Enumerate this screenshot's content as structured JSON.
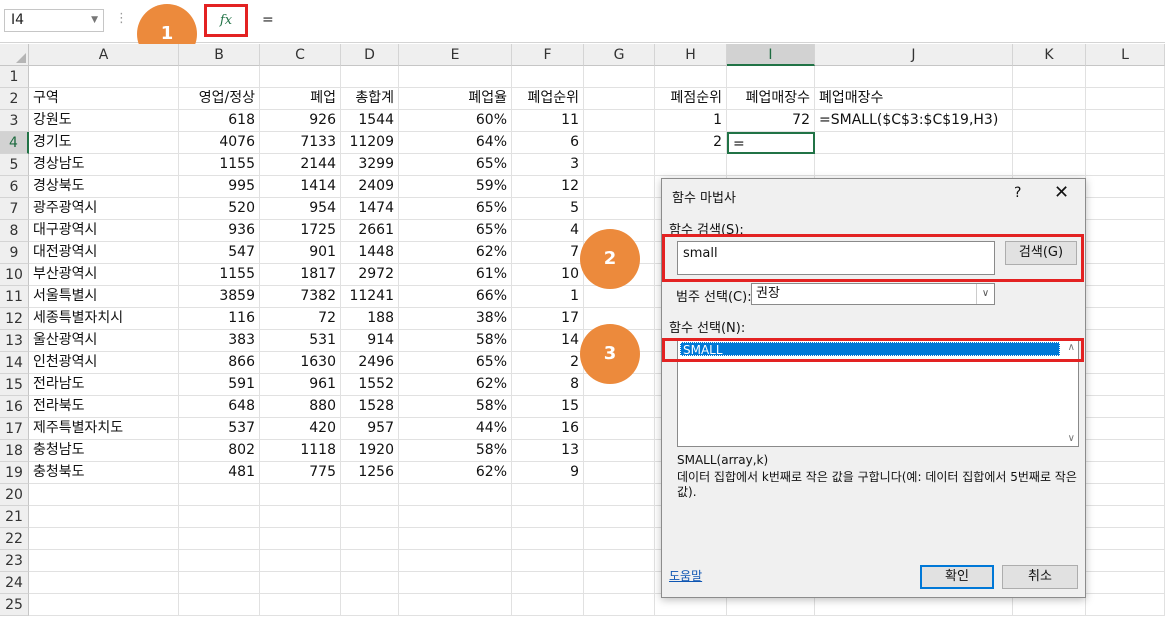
{
  "formula_bar": {
    "name_box": "I4",
    "fx_label": "fx",
    "content": "="
  },
  "badges": [
    "1",
    "2",
    "3"
  ],
  "columns": [
    "A",
    "B",
    "C",
    "D",
    "E",
    "F",
    "G",
    "H",
    "I",
    "J",
    "K",
    "L"
  ],
  "selected_column": "I",
  "selected_row": "4",
  "rows": [
    {
      "n": "1",
      "A": "",
      "B": "",
      "C": "",
      "D": "",
      "E": "",
      "F": "",
      "H": "",
      "I": "",
      "J": ""
    },
    {
      "n": "2",
      "A": "구역",
      "B": "영업/정상",
      "C": "폐업",
      "D": "총합계",
      "E": "폐업율",
      "F": "폐업순위",
      "H": "폐점순위",
      "I": "폐업매장수",
      "J": "폐업매장수"
    },
    {
      "n": "3",
      "A": "강원도",
      "B": "618",
      "C": "926",
      "D": "1544",
      "E": "60%",
      "F": "11",
      "H": "1",
      "I": "72",
      "J": "=SMALL($C$3:$C$19,H3)"
    },
    {
      "n": "4",
      "A": "경기도",
      "B": "4076",
      "C": "7133",
      "D": "11209",
      "E": "64%",
      "F": "6",
      "H": "2",
      "I": "=",
      "J": ""
    },
    {
      "n": "5",
      "A": "경상남도",
      "B": "1155",
      "C": "2144",
      "D": "3299",
      "E": "65%",
      "F": "3",
      "H": "",
      "I": "",
      "J": ""
    },
    {
      "n": "6",
      "A": "경상북도",
      "B": "995",
      "C": "1414",
      "D": "2409",
      "E": "59%",
      "F": "12",
      "H": "",
      "I": "",
      "J": ""
    },
    {
      "n": "7",
      "A": "광주광역시",
      "B": "520",
      "C": "954",
      "D": "1474",
      "E": "65%",
      "F": "5",
      "H": "",
      "I": "",
      "J": ""
    },
    {
      "n": "8",
      "A": "대구광역시",
      "B": "936",
      "C": "1725",
      "D": "2661",
      "E": "65%",
      "F": "4",
      "H": "",
      "I": "",
      "J": ""
    },
    {
      "n": "9",
      "A": "대전광역시",
      "B": "547",
      "C": "901",
      "D": "1448",
      "E": "62%",
      "F": "7",
      "H": "",
      "I": "",
      "J": ""
    },
    {
      "n": "10",
      "A": "부산광역시",
      "B": "1155",
      "C": "1817",
      "D": "2972",
      "E": "61%",
      "F": "10",
      "H": "",
      "I": "",
      "J": ""
    },
    {
      "n": "11",
      "A": "서울특별시",
      "B": "3859",
      "C": "7382",
      "D": "11241",
      "E": "66%",
      "F": "1",
      "H": "",
      "I": "",
      "J": ""
    },
    {
      "n": "12",
      "A": "세종특별자치시",
      "B": "116",
      "C": "72",
      "D": "188",
      "E": "38%",
      "F": "17",
      "H": "",
      "I": "",
      "J": ""
    },
    {
      "n": "13",
      "A": "울산광역시",
      "B": "383",
      "C": "531",
      "D": "914",
      "E": "58%",
      "F": "14",
      "H": "",
      "I": "",
      "J": ""
    },
    {
      "n": "14",
      "A": "인천광역시",
      "B": "866",
      "C": "1630",
      "D": "2496",
      "E": "65%",
      "F": "2",
      "H": "",
      "I": "",
      "J": ""
    },
    {
      "n": "15",
      "A": "전라남도",
      "B": "591",
      "C": "961",
      "D": "1552",
      "E": "62%",
      "F": "8",
      "H": "",
      "I": "",
      "J": ""
    },
    {
      "n": "16",
      "A": "전라북도",
      "B": "648",
      "C": "880",
      "D": "1528",
      "E": "58%",
      "F": "15",
      "H": "",
      "I": "",
      "J": ""
    },
    {
      "n": "17",
      "A": "제주특별자치도",
      "B": "537",
      "C": "420",
      "D": "957",
      "E": "44%",
      "F": "16",
      "H": "",
      "I": "",
      "J": ""
    },
    {
      "n": "18",
      "A": "충청남도",
      "B": "802",
      "C": "1118",
      "D": "1920",
      "E": "58%",
      "F": "13",
      "H": "",
      "I": "",
      "J": ""
    },
    {
      "n": "19",
      "A": "충청북도",
      "B": "481",
      "C": "775",
      "D": "1256",
      "E": "62%",
      "F": "9",
      "H": "",
      "I": "",
      "J": ""
    },
    {
      "n": "20"
    },
    {
      "n": "21"
    },
    {
      "n": "22"
    },
    {
      "n": "23"
    },
    {
      "n": "24"
    },
    {
      "n": "25"
    }
  ],
  "dialog": {
    "title": "함수 마법사",
    "help": "?",
    "close": "✕",
    "search_label": "함수 검색(S):",
    "search_value": "small",
    "search_button": "검색(G)",
    "category_label": "범주 선택(C):",
    "category_value": "권장",
    "function_label": "함수 선택(N):",
    "functions": [
      "SMALL"
    ],
    "syntax": "SMALL(array,k)",
    "description": "데이터 집합에서 k번째로 작은 값을 구합니다(예: 데이터 집합에서 5번째로 작은 값).",
    "help_link": "도움말",
    "ok_button": "확인",
    "cancel_button": "취소"
  }
}
